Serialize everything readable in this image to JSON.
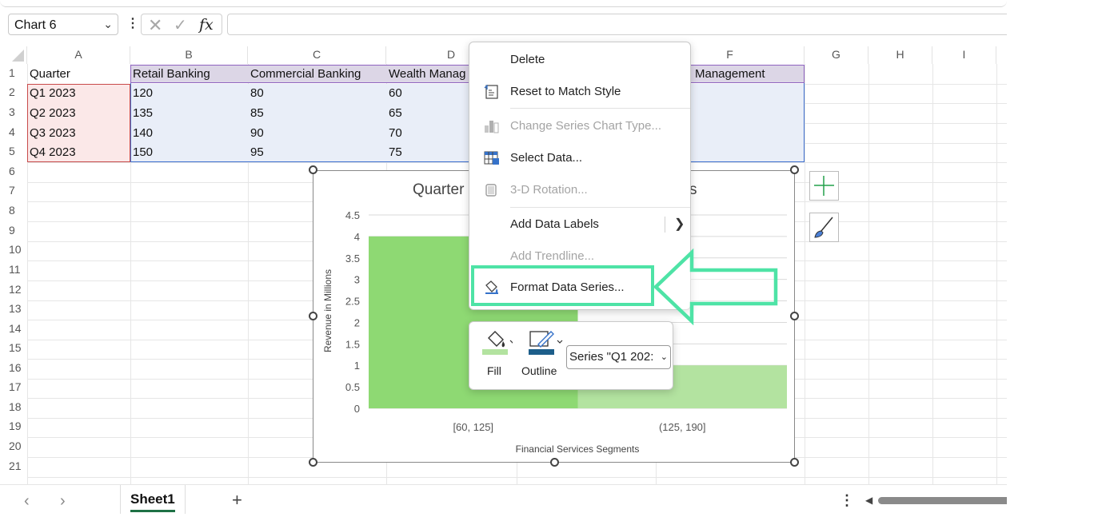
{
  "namebox": {
    "value": "Chart 6"
  },
  "formula_bar": {
    "fx_label": "fx",
    "value": ""
  },
  "columns": [
    "A",
    "B",
    "C",
    "D",
    "E",
    "F",
    "G",
    "H",
    "I"
  ],
  "rows": [
    "1",
    "2",
    "3",
    "4",
    "5",
    "6",
    "7",
    "8",
    "9",
    "10",
    "11",
    "12",
    "13",
    "14",
    "15",
    "16",
    "17",
    "18",
    "19",
    "20",
    "21"
  ],
  "table": {
    "headers": [
      "Quarter",
      "Retail Banking",
      "Commercial Banking",
      "Wealth Manag",
      "Management"
    ],
    "data": [
      [
        "Q1 2023",
        "120",
        "80",
        "60"
      ],
      [
        "Q2 2023",
        "135",
        "85",
        "65"
      ],
      [
        "Q3 2023",
        "140",
        "90",
        "70"
      ],
      [
        "Q4 2023",
        "150",
        "95",
        "75"
      ]
    ]
  },
  "chart": {
    "title_left": "Quarter",
    "title_right": "s",
    "ylabel": "Revenue in Millions",
    "xlabel": "Financial Services Segments"
  },
  "chart_data": {
    "type": "bar",
    "title": "",
    "xlabel": "Financial Services Segments",
    "ylabel": "Revenue in Millions",
    "categories": [
      "[60, 125]",
      "(125, 190]"
    ],
    "values": [
      4,
      1
    ],
    "ylim": [
      0,
      4.5
    ],
    "yticks": [
      "0",
      "0.5",
      "1",
      "1.5",
      "2",
      "2.5",
      "3",
      "3.5",
      "4",
      "4.5"
    ],
    "grid": true,
    "colors": [
      "#8ed973",
      "#b3e3a0"
    ]
  },
  "context_menu": {
    "items": [
      {
        "label": "Delete",
        "disabled": false,
        "icon": "none"
      },
      {
        "label": "Reset to Match Style",
        "disabled": false,
        "icon": "reset-style-icon"
      },
      {
        "label": "Change Series Chart Type...",
        "disabled": true,
        "icon": "chart-type-icon"
      },
      {
        "label": "Select Data...",
        "disabled": false,
        "icon": "select-data-icon"
      },
      {
        "label": "3-D Rotation...",
        "disabled": true,
        "icon": "rotation-icon"
      },
      {
        "label": "Add Data Labels",
        "disabled": false,
        "icon": "none"
      },
      {
        "label": "Add Trendline...",
        "disabled": true,
        "icon": "none"
      },
      {
        "label": "Format Data Series...",
        "disabled": false,
        "icon": "format-series-icon"
      }
    ]
  },
  "mini_toolbar": {
    "fill_label": "Fill",
    "outline_label": "Outline",
    "series_select": "Series \"Q1 202:"
  },
  "sheet_tabs": {
    "active": "Sheet1",
    "add": "+"
  },
  "colors": {
    "highlight": "#4ee3a6",
    "excel_green": "#1e7145",
    "bar1": "#8ed973",
    "bar2": "#b3e3a0"
  }
}
